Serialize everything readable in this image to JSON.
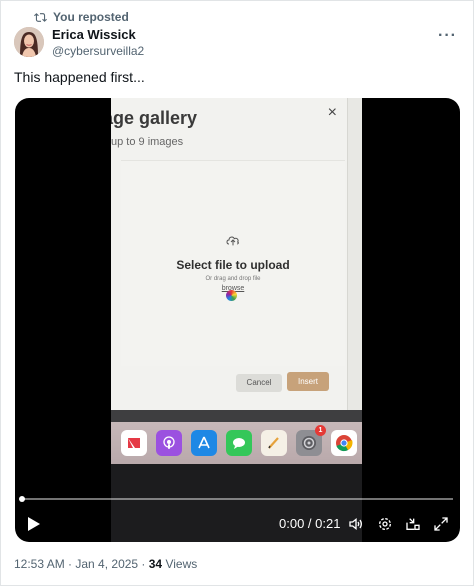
{
  "repost": {
    "label": "You reposted"
  },
  "author": {
    "name": "Erica Wissick",
    "handle": "@cybersurveilla2"
  },
  "more_label": "···",
  "tweet": {
    "text": "This happened first..."
  },
  "video": {
    "frame": {
      "dialog_title": "age gallery",
      "dialog_subtitle": "up to 9 images",
      "close_symbol": "×",
      "dropzone_title": "Select file to upload",
      "dropzone_hint": "Or drag and drop file",
      "browse_label": "browse",
      "cancel_label": "Cancel",
      "insert_label": "Insert",
      "settings_badge": "1"
    },
    "time": "0:00 / 0:21",
    "progress": 0.0
  },
  "meta": {
    "timestamp": "12:53 AM · Jan 4, 2025 · ",
    "views_count": "34",
    "views_label": " Views"
  }
}
